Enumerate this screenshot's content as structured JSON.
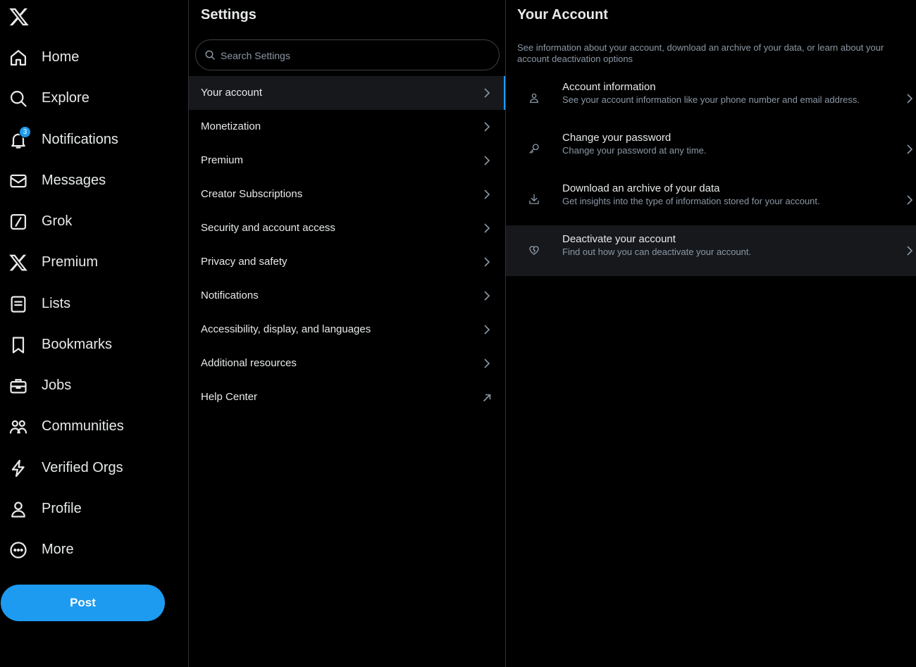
{
  "nav": {
    "logo_icon": "x-logo-icon",
    "notifications_badge": "3",
    "items": [
      {
        "label": "Home",
        "icon": "home-icon"
      },
      {
        "label": "Explore",
        "icon": "search-icon"
      },
      {
        "label": "Notifications",
        "icon": "bell-icon"
      },
      {
        "label": "Messages",
        "icon": "mail-icon"
      },
      {
        "label": "Grok",
        "icon": "grok-icon"
      },
      {
        "label": "Premium",
        "icon": "x-premium-icon"
      },
      {
        "label": "Lists",
        "icon": "list-icon"
      },
      {
        "label": "Bookmarks",
        "icon": "bookmark-icon"
      },
      {
        "label": "Jobs",
        "icon": "briefcase-icon"
      },
      {
        "label": "Communities",
        "icon": "people-icon"
      },
      {
        "label": "Verified Orgs",
        "icon": "lightning-icon"
      },
      {
        "label": "Profile",
        "icon": "person-icon"
      },
      {
        "label": "More",
        "icon": "more-circle-icon"
      }
    ],
    "post_label": "Post"
  },
  "settings": {
    "title": "Settings",
    "search_placeholder": "Search Settings",
    "items": [
      {
        "label": "Your account",
        "active": true
      },
      {
        "label": "Monetization"
      },
      {
        "label": "Premium"
      },
      {
        "label": "Creator Subscriptions"
      },
      {
        "label": "Security and account access"
      },
      {
        "label": "Privacy and safety"
      },
      {
        "label": "Notifications"
      },
      {
        "label": "Accessibility, display, and languages"
      },
      {
        "label": "Additional resources"
      },
      {
        "label": "Help Center",
        "external": true
      }
    ]
  },
  "account": {
    "title": "Your Account",
    "description": "See information about your account, download an archive of your data, or learn about your account deactivation options",
    "options": [
      {
        "title": "Account information",
        "desc": "See your account information like your phone number and email address.",
        "icon": "person-icon"
      },
      {
        "title": "Change your password",
        "desc": "Change your password at any time.",
        "icon": "key-icon"
      },
      {
        "title": "Download an archive of your data",
        "desc": "Get insights into the type of information stored for your account.",
        "icon": "download-icon"
      },
      {
        "title": "Deactivate your account",
        "desc": "Find out how you can deactivate your account.",
        "icon": "broken-heart-icon"
      }
    ]
  },
  "colors": {
    "background": "#000000",
    "accent": "#1d9bf0",
    "text_primary": "#e7e9ea",
    "text_secondary": "#8b98a5",
    "border": "#2f3336",
    "hover": "#16181c"
  }
}
